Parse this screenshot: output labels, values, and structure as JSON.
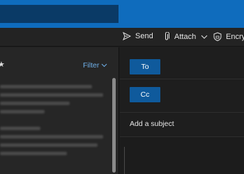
{
  "toolbar": {
    "send_label": "Send",
    "attach_label": "Attach",
    "encrypt_label": "Encry"
  },
  "left_pane": {
    "filter_label": "Filter"
  },
  "compose": {
    "to_label": "To",
    "cc_label": "Cc",
    "subject_placeholder": "Add a subject"
  },
  "colors": {
    "accent": "#0f6cbd",
    "button": "#0f5a9c",
    "link": "#6fb0ea"
  }
}
